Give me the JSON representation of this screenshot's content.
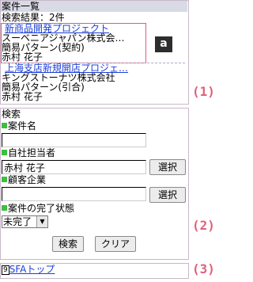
{
  "header": {
    "title": "案件一覧",
    "result_text": "検索結果：2件"
  },
  "results": [
    {
      "title": "新商品開発プロジェクト",
      "company": "スーベニアジャパン株式会…",
      "pattern": "簡易パターン(契約)",
      "owner": "赤村 花子"
    },
    {
      "title": "上海支店新規開店プロジェ…",
      "company": "キングストーナツ株式会社",
      "pattern": "簡易パターン(引合)",
      "owner": "赤村 花子"
    }
  ],
  "annotations": {
    "badge_a": "a",
    "callout_1": "(1)",
    "callout_2": "(2)",
    "callout_3": "(3)"
  },
  "search": {
    "title": "検索",
    "fields": {
      "name": {
        "label": "案件名",
        "value": ""
      },
      "owner": {
        "label": "自社担当者",
        "value": "赤村 花子",
        "button": "選択"
      },
      "customer": {
        "label": "顧客企業",
        "value": "",
        "button": "選択"
      },
      "status": {
        "label": "案件の完了状態",
        "selected": "未完了"
      }
    },
    "search_button": "検索",
    "clear_button": "クリア"
  },
  "footer": {
    "accesskey": "9",
    "link": "SFAトップ"
  },
  "colors": {
    "link": "#1d3fd6",
    "callout": "#e0607a",
    "title_bar": "#d8dae6",
    "marker": "#3cbf3c"
  }
}
